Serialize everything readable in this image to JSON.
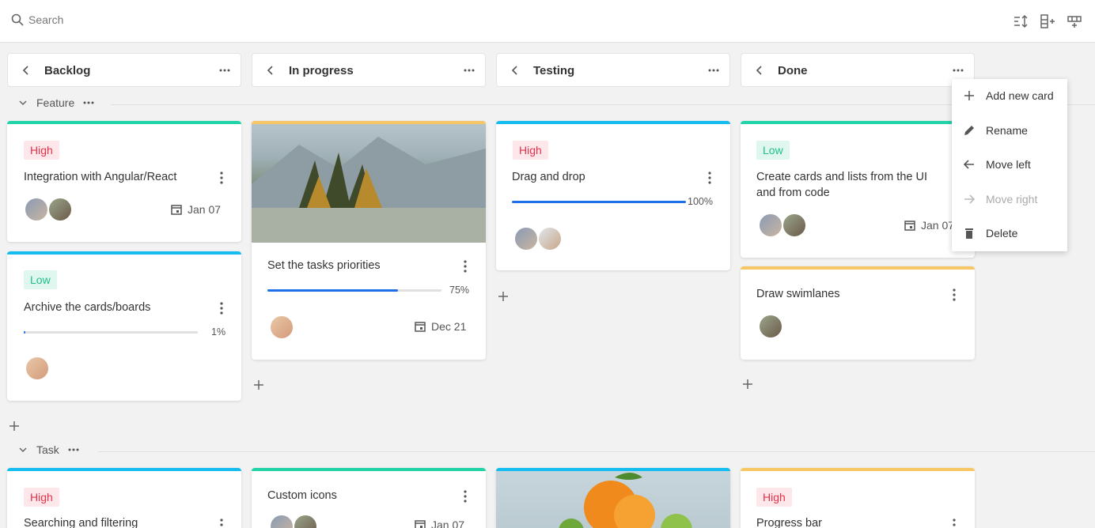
{
  "toolbar": {
    "search_placeholder": "Search"
  },
  "columns": [
    {
      "title": "Backlog"
    },
    {
      "title": "In progress"
    },
    {
      "title": "Testing"
    },
    {
      "title": "Done"
    }
  ],
  "swimlanes": [
    {
      "title": "Feature"
    },
    {
      "title": "Task"
    }
  ],
  "cards": {
    "c1": {
      "priority": "High",
      "title": "Integration with Angular/React",
      "date": "Jan 07"
    },
    "c2": {
      "priority": "Low",
      "title": "Archive the cards/boards",
      "progress": "1%",
      "progress_value": 0.01
    },
    "c3": {
      "title": "Set the tasks priorities",
      "progress": "75%",
      "progress_value": 0.75,
      "date": "Dec 21"
    },
    "c4": {
      "priority": "High",
      "title": "Drag and drop",
      "progress": "100%",
      "progress_value": 1.0
    },
    "c5": {
      "priority": "Low",
      "title": "Create cards and lists from the UI and from code",
      "date": "Jan 07"
    },
    "c6": {
      "title": "Draw swimlanes"
    },
    "t1": {
      "priority": "High",
      "title": "Searching and filtering"
    },
    "t2": {
      "title": "Custom icons",
      "date": "Jan 07"
    },
    "t4": {
      "priority": "High",
      "title": "Progress bar"
    }
  },
  "menu": {
    "add": "Add new card",
    "rename": "Rename",
    "move_left": "Move left",
    "move_right": "Move right",
    "delete": "Delete"
  },
  "colors": {
    "green": "#23d3a8",
    "blue": "#14bcf0",
    "yellow": "#f7c766",
    "high_text": "#e2324a",
    "low_text": "#1fbf8a",
    "progress": "#1e6fe8"
  }
}
